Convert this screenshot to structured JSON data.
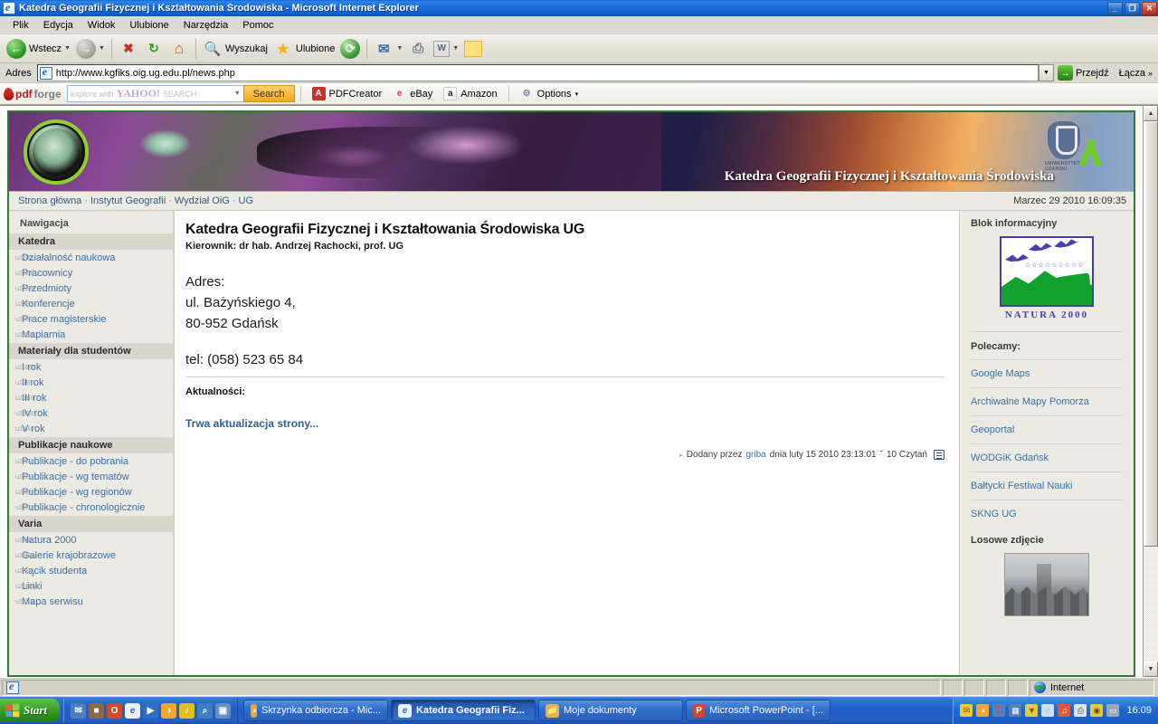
{
  "window": {
    "title": "Katedra Geografii Fizycznej i Kształtowania Środowiska - Microsoft Internet Explorer",
    "minimize": "_",
    "maximize": "❐",
    "close": "✕"
  },
  "menu": {
    "items": [
      "Plik",
      "Edycja",
      "Widok",
      "Ulubione",
      "Narzędzia",
      "Pomoc"
    ]
  },
  "toolbar": {
    "back": "Wstecz",
    "forward": "",
    "stop": "✖",
    "refresh": "↻",
    "home": "⌂",
    "search": "Wyszukaj",
    "favorites": "Ulubione",
    "history": "⟳",
    "mail": "✉",
    "print": "⎙",
    "edit": "W",
    "messenger": ""
  },
  "address": {
    "label": "Adres",
    "url": "http://www.kgfiks.oig.ug.edu.pl/news.php",
    "go": "Przejdź",
    "links": "Łącza",
    "links_chevron": "»",
    "dropdown": "▼"
  },
  "pdfbar": {
    "brand_pdf": "pdf",
    "brand_forge": "forge",
    "search_placeholder": "explore with",
    "yahoo": "YAHOO!",
    "yahoo_search": "SEARCH",
    "search_button": "Search",
    "items": [
      {
        "label": "PDFCreator",
        "icon": "pdf-icon"
      },
      {
        "label": "eBay",
        "icon": "ebay-icon"
      },
      {
        "label": "Amazon",
        "icon": "amazon-icon"
      }
    ],
    "options": "Options",
    "options_arrow": "▾"
  },
  "page": {
    "banner_title": "Katedra Geografii Fizycznej i Kształtowania Środowiska",
    "seal_text": "Katedra Geografii Fizycznej i Kształtowania Środowiska",
    "university_logo_caption": "UNIWERSYTET GDAŃSKI",
    "breadcrumb": [
      "Strona główna",
      "Instytut Geografii",
      "Wydział OiG",
      "UG"
    ],
    "breadcrumb_separator": "·",
    "date": "Marzec 29 2010 16:09:35",
    "nav_header": "Nawigacja",
    "nav_groups": [
      {
        "title": "Katedra",
        "links": [
          "Działalność naukowa",
          "Pracownicy",
          "Przedmioty",
          "Konferencje",
          "Prace magisterskie",
          "Mapiarnia"
        ]
      },
      {
        "title": "Materiały dla studentów",
        "links": [
          "I rok",
          "II rok",
          "III rok",
          "IV rok",
          "V rok"
        ]
      },
      {
        "title": "Publikacje naukowe",
        "links": [
          "Publikacje - do pobrania",
          "Publikacje - wg tematów",
          "Publikacje - wg regionów",
          "Publikacje - chronologicznie"
        ]
      },
      {
        "title": "Varia",
        "links": [
          "Natura 2000",
          "Galerie krajobrazowe",
          "Kącik studenta",
          "Linki",
          "Mapa serwisu"
        ]
      }
    ],
    "main": {
      "title": "Katedra Geografii Fizycznej i Kształtowania Środowiska UG",
      "subtitle": "Kierownik: dr hab. Andrzej Rachocki, prof. UG",
      "address_label": "Adres:",
      "address_line1": "ul. Bażyńskiego 4,",
      "address_line2": "80-952 Gdańsk",
      "tel": "tel: (058) 523 65 84",
      "news_header": "Aktualności:",
      "news_title": "Trwa aktualizacja strony...",
      "meta_prefix": "Dodany przez",
      "meta_author": "griba",
      "meta_middle": "dnia luty 15 2010 23:13:01",
      "meta_sep": "ˇ",
      "meta_reads": "10 Czytań"
    },
    "right": {
      "info_header": "Blok informacyjny",
      "natura_caption": "NATURA 2000",
      "recommend_header": "Polecamy:",
      "recommend_links": [
        "Google Maps",
        "Archiwalne Mapy Pomorza",
        "Geoportal",
        "WODGiK Gdańsk",
        "Bałtycki Festiwal Nauki",
        "SKNG UG"
      ],
      "random_photo_header": "Losowe zdjęcie"
    }
  },
  "statusbar": {
    "zone": "Internet"
  },
  "taskbar": {
    "start": "Start",
    "quicklaunch": [
      {
        "name": "outlook-icon",
        "glyph": "✉"
      },
      {
        "name": "camera-icon",
        "glyph": "■"
      },
      {
        "name": "opera-icon",
        "glyph": "O"
      },
      {
        "name": "internet-explorer-icon",
        "glyph": "e"
      },
      {
        "name": "media-player-icon",
        "glyph": "▶"
      },
      {
        "name": "mail-client-icon",
        "glyph": "◑"
      },
      {
        "name": "winamp-icon",
        "glyph": "♪"
      },
      {
        "name": "search-icon",
        "glyph": "⌕"
      },
      {
        "name": "show-desktop-icon",
        "glyph": "▣"
      }
    ],
    "tasks": [
      {
        "label": "Skrzynka odbiorcza - Mic...",
        "icon": "outlook-icon",
        "active": false
      },
      {
        "label": "Katedra Geografii Fiz...",
        "icon": "internet-explorer-icon",
        "active": true
      },
      {
        "label": "Moje dokumenty",
        "icon": "folder-icon",
        "active": false
      },
      {
        "label": "Microsoft PowerPoint - [...",
        "icon": "powerpoint-icon",
        "active": false
      }
    ],
    "tray": [
      {
        "name": "mail-tray-icon",
        "glyph": "✉"
      },
      {
        "name": "mail-client-tray-icon",
        "glyph": "◑"
      },
      {
        "name": "network-disconnected-icon",
        "glyph": "❐"
      },
      {
        "name": "network-icon",
        "glyph": "▦"
      },
      {
        "name": "security-shield-icon",
        "glyph": "▼"
      },
      {
        "name": "update-icon",
        "glyph": "◌"
      },
      {
        "name": "volume-icon",
        "glyph": "♫"
      },
      {
        "name": "printer-tray-icon",
        "glyph": "⎙"
      },
      {
        "name": "antivirus-icon",
        "glyph": "◉"
      },
      {
        "name": "display-icon",
        "glyph": "▭"
      }
    ],
    "clock": "16:09"
  },
  "colors": {
    "accent_blue": "#1b6fdb",
    "site_border_green": "#2f7d2f",
    "link_blue": "#3a6ea5",
    "page_bg": "#ecebe3",
    "category_bg": "#d8d6cc"
  }
}
